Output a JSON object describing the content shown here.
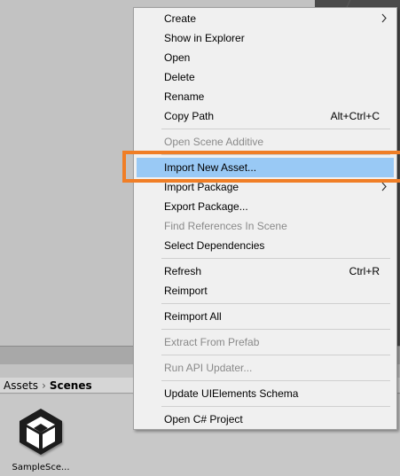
{
  "breadcrumb": {
    "root": "Assets",
    "current": "Scenes"
  },
  "asset": {
    "label": "SampleSce..."
  },
  "menu": {
    "items": [
      {
        "label": "Create",
        "submenu": true
      },
      {
        "label": "Show in Explorer"
      },
      {
        "label": "Open"
      },
      {
        "label": "Delete"
      },
      {
        "label": "Rename"
      },
      {
        "label": "Copy Path",
        "shortcut": "Alt+Ctrl+C"
      },
      {
        "label": "Open Scene Additive",
        "disabled": true
      },
      {
        "label": "Import New Asset...",
        "highlighted": true
      },
      {
        "label": "Import Package",
        "submenu": true
      },
      {
        "label": "Export Package..."
      },
      {
        "label": "Find References In Scene",
        "disabled": true
      },
      {
        "label": "Select Dependencies"
      },
      {
        "label": "Refresh",
        "shortcut": "Ctrl+R"
      },
      {
        "label": "Reimport"
      },
      {
        "label": "Reimport All"
      },
      {
        "label": "Extract From Prefab",
        "disabled": true
      },
      {
        "label": "Run API Updater...",
        "disabled": true
      },
      {
        "label": "Update UIElements Schema"
      },
      {
        "label": "Open C# Project"
      }
    ]
  },
  "colors": {
    "highlight": "#99c9f5",
    "callout": "#f07e26",
    "disabled_text": "#8a8a8a"
  },
  "icons": {
    "submenu": "chevron-right-icon",
    "asset": "unity-logo-icon"
  }
}
